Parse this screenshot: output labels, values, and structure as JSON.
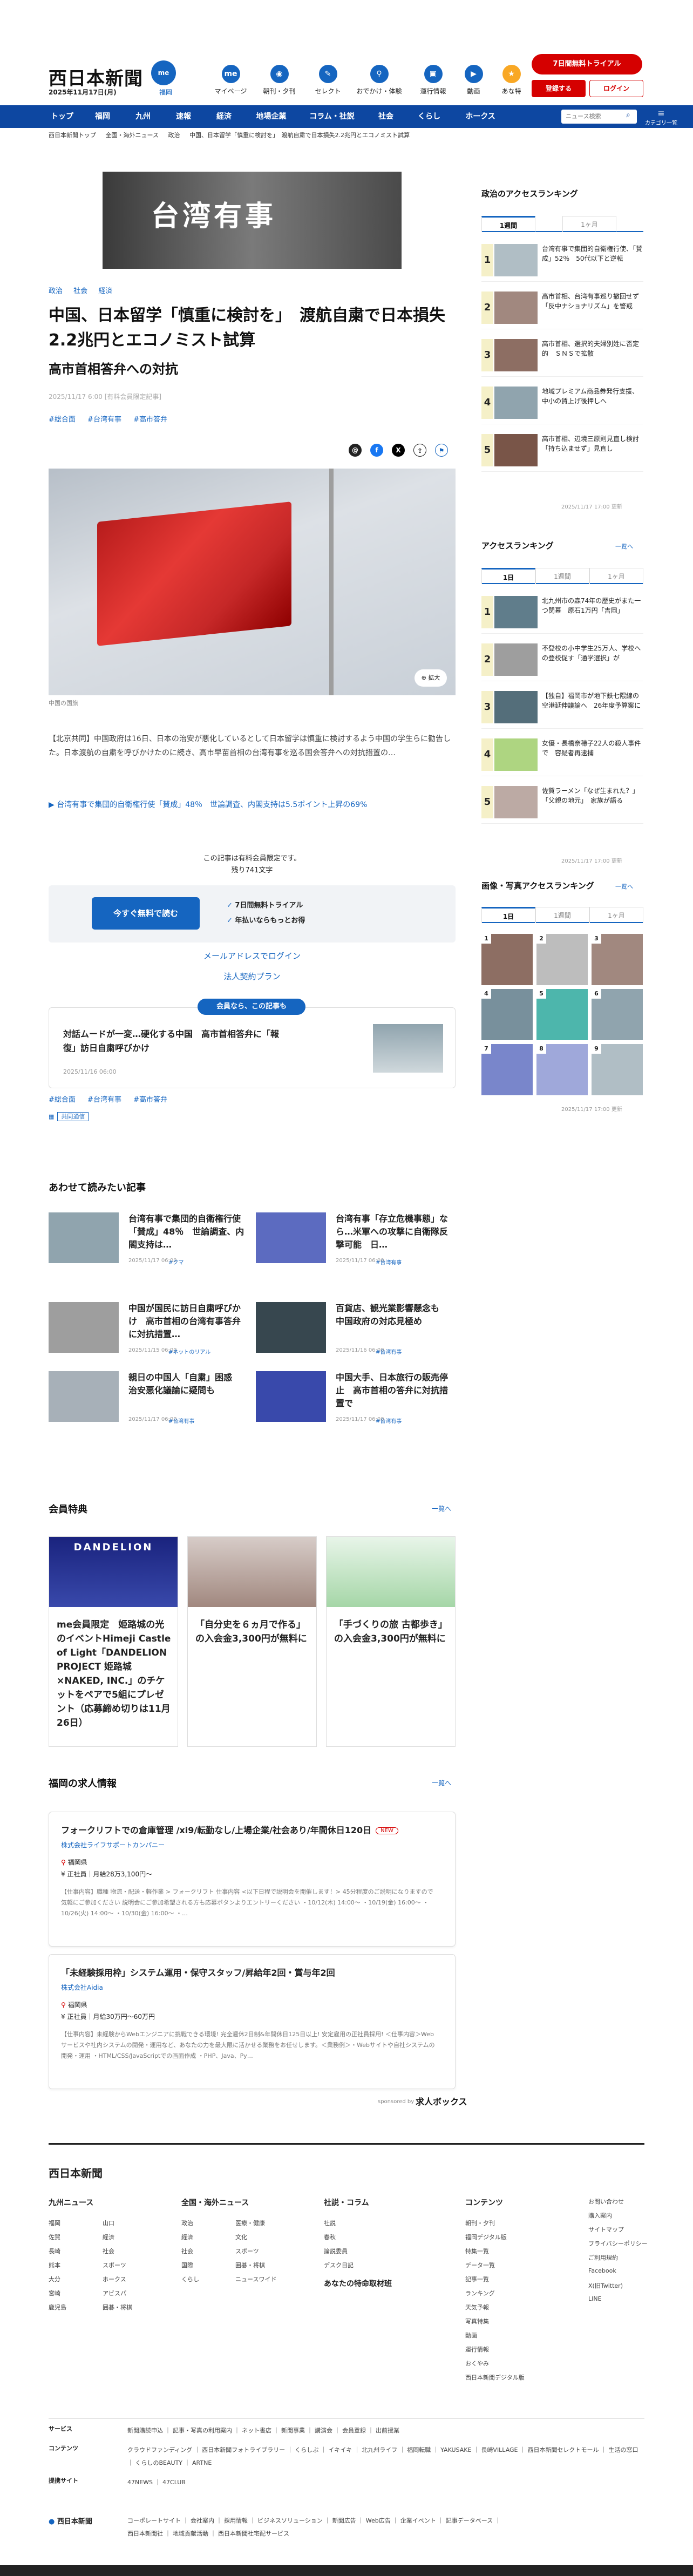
{
  "header": {
    "logo": "西日本新聞",
    "logo_badge": "me",
    "date": "2025年11月17日(月)",
    "weather": "福岡",
    "icons": [
      {
        "label": "マイページ",
        "icon": "me-icon"
      },
      {
        "label": "朝刊・夕刊",
        "icon": "newspaper-icon"
      },
      {
        "label": "セレクト",
        "icon": "select-icon"
      },
      {
        "label": "おでかけ・体験",
        "icon": "footprints-icon"
      },
      {
        "label": "運行情報",
        "icon": "train-icon"
      },
      {
        "label": "動画",
        "icon": "video-icon"
      },
      {
        "label": "あな特",
        "icon": "anatoku-icon"
      }
    ],
    "trial_button": "7日間無料トライアル",
    "register_button": "登録する",
    "login_button": "ログイン"
  },
  "nav": {
    "items": [
      "トップ",
      "福岡",
      "九州",
      "速報",
      "経済",
      "地場企業",
      "コラム・社説",
      "社会",
      "くらし",
      "ホークス"
    ],
    "search_placeholder": "ニュース検索",
    "category_label": "カテゴリ一覧"
  },
  "breadcrumb": [
    "西日本新聞トップ",
    "全国・海外ニュース",
    "政治",
    "中国、日本留学「慎重に検討を」　渡航自粛で日本損失2.2兆円とエコノミスト試算"
  ],
  "ad": {
    "text": "台湾有事"
  },
  "article": {
    "tags": [
      "政治",
      "社会",
      "経済"
    ],
    "title": "中国、日本留学「慎重に検討を」　渡航自粛で日本損失2.2兆円とエコノミスト試算",
    "subtitle": "高市首相答弁への対抗",
    "pubdate": "2025/11/17 6:00 [有料会員限定記事]",
    "keywords": [
      "#総合面",
      "#台湾有事",
      "#高市答弁"
    ],
    "photo_caption": "中国の国旗",
    "zoom_label": "拡大",
    "lead": "【北京共同】中国政府は16日、日本の治安が悪化しているとして日本留学は慎重に検討するよう中国の学生らに勧告した。日本渡航の自粛を呼びかけたのに続き、高市早苗首相の台湾有事を巡る国会答弁への対抗措置の…",
    "related_link": "▶ 台湾有事で集団的自衛権行使「賛成」48％　世論調査、内閣支持は5.5ポイント上昇の69%",
    "paywall_note": "この記事は有料会員限定です。",
    "remaining": "残り741文字",
    "free_button": "今すぐ無料で読む",
    "trial_points": [
      "7日間無料トライアル",
      "年払いならもっとお得"
    ],
    "email_login": "メールアドレスでログイン",
    "corporate_link": "法人契約プラン",
    "members_pill": "会員なら、この記事も",
    "members_article": {
      "title": "対話ムードが一変…硬化する中国　高市首相答弁に「報復」訪日自粛呼びかけ",
      "date": "2025/11/16 06:00"
    },
    "bottom_keywords": [
      "#総合面",
      "#台湾有事",
      "#高市答弁"
    ],
    "dict_badge": "共同通信"
  },
  "sidebar": {
    "access_title": "政治のアクセスランキング",
    "access_tabs": [
      "1週間",
      "1ヶ月"
    ],
    "politics_ranking": [
      "台湾有事で集団的自衛権行使、「賛成」52％　50代以下と逆転",
      "高市首相、台湾有事巡り撤回せず「反中ナショナリズム」を警戒",
      "高市首相、選択的夫婦別姓に否定的　ＳＮＳで拡散",
      "地域プレミアム商品券発行支援、中小の賃上げ後押しへ",
      "高市首相、辺境三原則見直し検討「持ち込ませず」見直し"
    ],
    "politics_updated": "2025/11/17 17:00 更新",
    "ranking_title": "アクセスランキング",
    "ranking_more": "一覧へ",
    "ranking_tabs": [
      "1日",
      "1週間",
      "1ヶ月"
    ],
    "general_ranking": [
      "北九州市の森74年の歴史がまた一つ閉幕　原石1万円「吉岡」",
      "不登校の小中学生25万人、学校への登校促す「通学選択」が",
      "【独自】福岡市が地下鉄七隈線の空港延伸議論へ　26年度予算案に",
      "女優・長橋奈穂子22人の殺人事件で　容疑者再逮捕",
      "佐賀ラーメン「なぜ生まれた？」「父親の地元」　家族が語る"
    ],
    "general_updated": "2025/11/17 17:00 更新",
    "photo_title": "画像・写真アクセスランキング",
    "photo_more": "一覧へ",
    "photo_tabs": [
      "1日",
      "1週間",
      "1ヶ月"
    ],
    "photo_numbers": [
      "1",
      "2",
      "3",
      "4",
      "5",
      "6",
      "7",
      "8",
      "9"
    ],
    "photo_updated": "2025/11/17 17:00 更新"
  },
  "related": {
    "title": "あわせて読みたい記事",
    "items": [
      {
        "title": "台湾有事で集団的自衛権行使「賛成」48％　世論調査、内閣支持は…",
        "date": "2025/11/17 06:00",
        "tag": "#クマ"
      },
      {
        "title": "台湾有事「存立危機事態」なら…米軍への攻撃に自衛隊反撃可能　日…",
        "date": "2025/11/17 06:00",
        "tag": "#台湾有事"
      },
      {
        "title": "中国が国民に訪日自粛呼びかけ　高市首相の台湾有事答弁に対抗措置…",
        "date": "2025/11/15 06:00",
        "tag": "#ネットのリアル"
      },
      {
        "title": "百貨店、観光業影響懸念も　中国政府の対応見極め",
        "date": "2025/11/16 06:00",
        "tag": "#台湾有事"
      },
      {
        "title": "親日の中国人「自粛」困惑　治安悪化議論に疑問も",
        "date": "2025/11/17 06:00",
        "tag": "#台湾有事"
      },
      {
        "title": "中国大手、日本旅行の販売停止　高市首相の答弁に対抗措置で",
        "date": "2025/11/17 06:00",
        "tag": "#台湾有事"
      }
    ]
  },
  "benefits": {
    "title": "会員特典",
    "more": "一覧へ",
    "items": [
      {
        "title": "me会員限定　姫路城の光のイベントHimeji Castle of Light「DANDELION PROJECT 姫路城×NAKED, INC.」のチケットをペアで5組にプレゼント（応募締め切りは11月26日）",
        "image_text": "DANDELION"
      },
      {
        "title": "「自分史を６ヵ月で作る」の入会金3,300円が無料に",
        "image_text": ""
      },
      {
        "title": "「手づくりの旅 古都歩き」の入会金3,300円が無料に",
        "image_text": ""
      }
    ]
  },
  "jobs": {
    "title": "福岡の求人情報",
    "more": "一覧へ",
    "items": [
      {
        "title": "フォークリフトでの倉庫管理 /xi9/転勤なし/上場企業/社会あり/年間休日120日",
        "badge": "NEW",
        "company": "株式会社ライフサポートカンパニー",
        "location": "福岡県",
        "salary": "正社員｜月給28万3,100円〜",
        "desc": "【仕事内容】職種 物流・配送・軽作業 > フォークリフト 仕事内容 <以下日程で説明会を開催します！> 45分程度のご説明になりますので気軽にご参加ください 説明会にご参加希望される方も応募ボタンよりエントリーください ・10/12(木) 14:00〜 ・10/19(金) 16:00〜 ・10/26(火) 14:00〜 ・10/30(金) 16:00〜 ・…"
      },
      {
        "title": "「未経験採用枠」システム運用・保守スタッフ/昇給年2回・賞与年2回",
        "badge": "",
        "company": "株式会社Aidia",
        "location": "福岡県",
        "salary": "正社員｜月給30万円〜60万円",
        "desc": "【仕事内容】未経験からWebエンジニアに挑戦できる環境! 完全週休2日制&年間休日125日以上! 安定雇用の正社員採用! ＜仕事内容＞Webサービスや社内システムの開発・運用など、あなたの力を最大限に活かせる業務をお任せします。＜業務例＞・Webサイトや自社システムの開発・運用 ・HTML/CSS/JavaScriptでの画面作成 ・PHP、Java、Py…"
      }
    ],
    "sponsored": "sponsored by",
    "partner": "求人ボックス"
  },
  "footer": {
    "logo": "西日本新聞",
    "columns": [
      {
        "title": "九州ニュース",
        "links": [
          "福岡",
          "佐賀",
          "長崎",
          "熊本",
          "大分",
          "宮崎",
          "鹿児島",
          "山口",
          "経済",
          "社会",
          "スポーツ",
          "ホークス",
          "アビスパ",
          "囲碁・将棋"
        ]
      },
      {
        "title": "全国・海外ニュース",
        "links": [
          "政治",
          "経済",
          "社会",
          "国際",
          "くらし",
          "医療・健康",
          "文化",
          "スポーツ",
          "囲碁・将棋",
          "ニュースワイド"
        ]
      },
      {
        "title": "社説・コラム",
        "links": [
          "社説",
          "春秋",
          "論説委員",
          "デスク日記"
        ]
      },
      {
        "title": "コンテンツ",
        "links": [
          "朝刊・夕刊",
          "福岡デジタル版",
          "特集一覧",
          "データ一覧",
          "記事一覧",
          "ランキング",
          "天気予報",
          "写真特集",
          "動画",
          "運行情報",
          "おくやみ",
          "西日本新聞デジタル版"
        ]
      },
      {
        "title": "",
        "links": [
          "お問い合わせ",
          "購入案内",
          "サイトマップ",
          "プライバシーポリシー",
          "ご利用規約",
          "Facebook",
          "X(旧Twitter)",
          "LINE"
        ]
      }
    ],
    "anatoku_title": "あなたの特命取材班",
    "rows": [
      {
        "head": "サービス",
        "value": "新聞購読申込 ｜ 記事・写真の利用案内 ｜ ネット書店 ｜ 新聞事業 ｜ 講演会 ｜ 会員登録 ｜ 出前授業"
      },
      {
        "head": "コンテンツ",
        "value": "クラウドファンディング ｜ 西日本新聞フォトライブラリー ｜ くらしぶ ｜ イキイキ ｜ 北九州ライフ ｜ 福岡転職 ｜ YAKUSAKE ｜ 長崎VILLAGE ｜ 西日本新聞セレクトモール ｜ 生活の窓口 ｜ くらしのBEAUTY ｜ ARTNE"
      },
      {
        "head": "提携サイト",
        "value": "47NEWS ｜ 47CLUB"
      }
    ],
    "bottom_logo": "西日本新聞",
    "bottom_links": "コーポレートサイト ｜ 会社案内 ｜ 採用情報 ｜ ビジネスソリューション ｜ 新聞広告 ｜ Web広告 ｜ 企業イベント ｜ 記事データベース ｜ 西日本新聞社 ｜ 地域貢献活動 ｜ 西日本新聞社宅配サービス"
  },
  "colors": {
    "brand": "#0d47a1",
    "accent": "#d50000",
    "link": "#1565c0"
  }
}
